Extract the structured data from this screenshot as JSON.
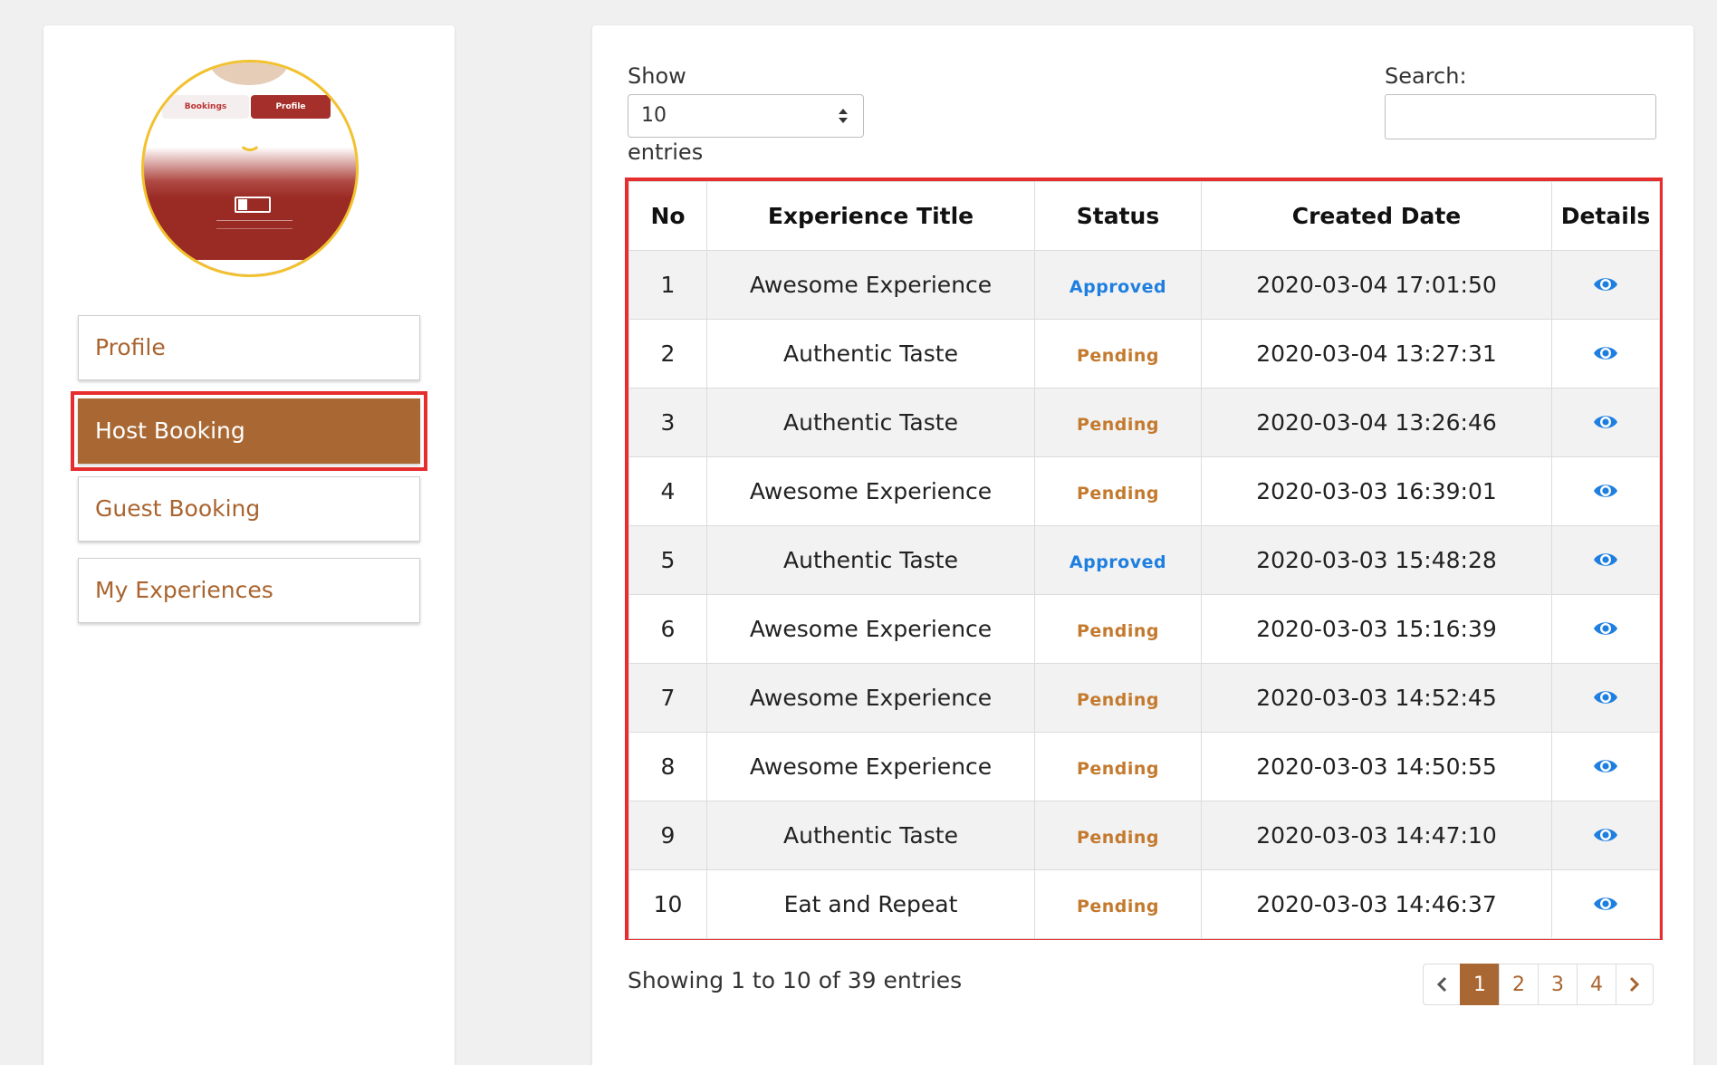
{
  "sidebar": {
    "avatar_tabs": [
      "Bookings",
      "Profile"
    ],
    "items": [
      {
        "label": "Profile",
        "active": false
      },
      {
        "label": "Host Booking",
        "active": true
      },
      {
        "label": "Guest Booking",
        "active": false
      },
      {
        "label": "My Experiences",
        "active": false
      }
    ]
  },
  "controls": {
    "show_label": "Show",
    "entries_label": "entries",
    "page_size_value": "10",
    "search_label": "Search:",
    "search_value": ""
  },
  "table": {
    "headers": [
      "No",
      "Experience Title",
      "Status",
      "Created Date",
      "Details"
    ],
    "rows": [
      {
        "no": "1",
        "title": "Awesome Experience",
        "status": "Approved",
        "date": "2020-03-04 17:01:50"
      },
      {
        "no": "2",
        "title": "Authentic Taste",
        "status": "Pending",
        "date": "2020-03-04 13:27:31"
      },
      {
        "no": "3",
        "title": "Authentic Taste",
        "status": "Pending",
        "date": "2020-03-04 13:26:46"
      },
      {
        "no": "4",
        "title": "Awesome Experience",
        "status": "Pending",
        "date": "2020-03-03 16:39:01"
      },
      {
        "no": "5",
        "title": "Authentic Taste",
        "status": "Approved",
        "date": "2020-03-03 15:48:28"
      },
      {
        "no": "6",
        "title": "Awesome Experience",
        "status": "Pending",
        "date": "2020-03-03 15:16:39"
      },
      {
        "no": "7",
        "title": "Awesome Experience",
        "status": "Pending",
        "date": "2020-03-03 14:52:45"
      },
      {
        "no": "8",
        "title": "Awesome Experience",
        "status": "Pending",
        "date": "2020-03-03 14:50:55"
      },
      {
        "no": "9",
        "title": "Authentic Taste",
        "status": "Pending",
        "date": "2020-03-03 14:47:10"
      },
      {
        "no": "10",
        "title": "Eat and Repeat",
        "status": "Pending",
        "date": "2020-03-03 14:46:37"
      }
    ],
    "details_icon": "eye-icon"
  },
  "footer": {
    "info": "Showing 1 to 10 of 39 entries",
    "pages": [
      "1",
      "2",
      "3",
      "4"
    ],
    "current_page": "1"
  },
  "colors": {
    "accent_brown": "#a96833",
    "approved_blue": "#1e7fe0",
    "pending_orange": "#c47a2e",
    "highlight_red": "#e62e2e",
    "avatar_ring": "#f2c12e"
  }
}
